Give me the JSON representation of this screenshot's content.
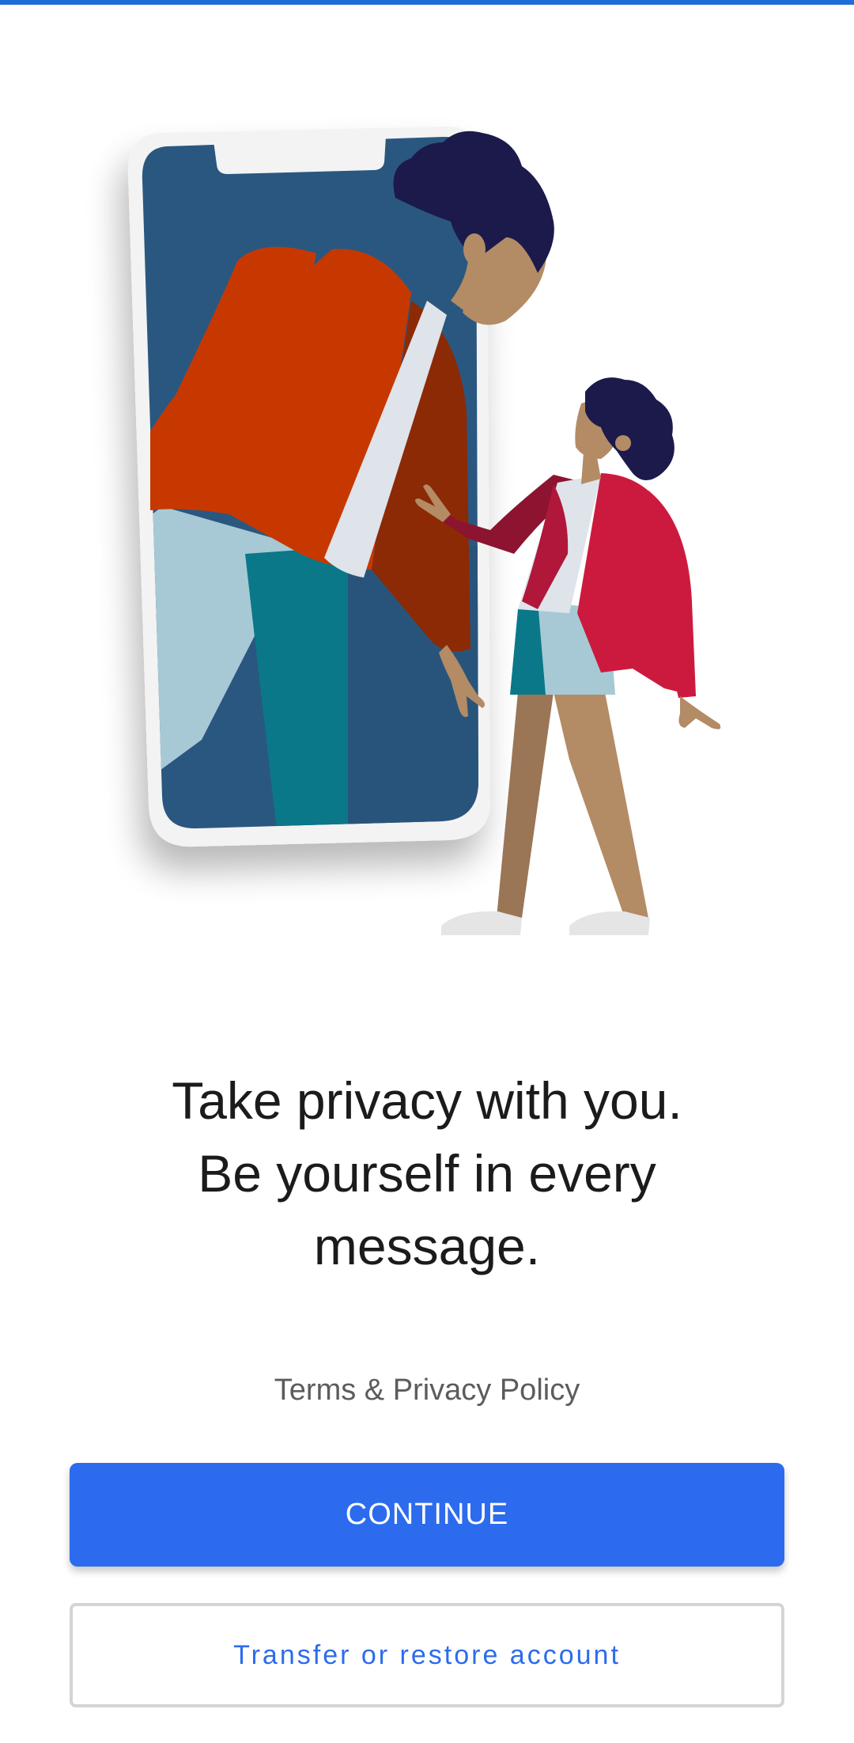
{
  "headline": {
    "line1": "Take privacy with you.",
    "line2": "Be yourself in every",
    "line3": "message."
  },
  "terms_link": "Terms & Privacy Policy",
  "buttons": {
    "continue": "CONTINUE",
    "transfer": "Transfer or restore account"
  },
  "illustration": {
    "name": "phone-with-woman-and-child-illustration"
  },
  "colors": {
    "accent": "#2c6bed",
    "top_strip": "#1d6fd6",
    "phone_screen": "#2a5780",
    "jacket_orange": "#c73800",
    "jacket_red": "#cc1a3e",
    "hair_navy": "#1c1a4b",
    "skin": "#b38b65"
  }
}
